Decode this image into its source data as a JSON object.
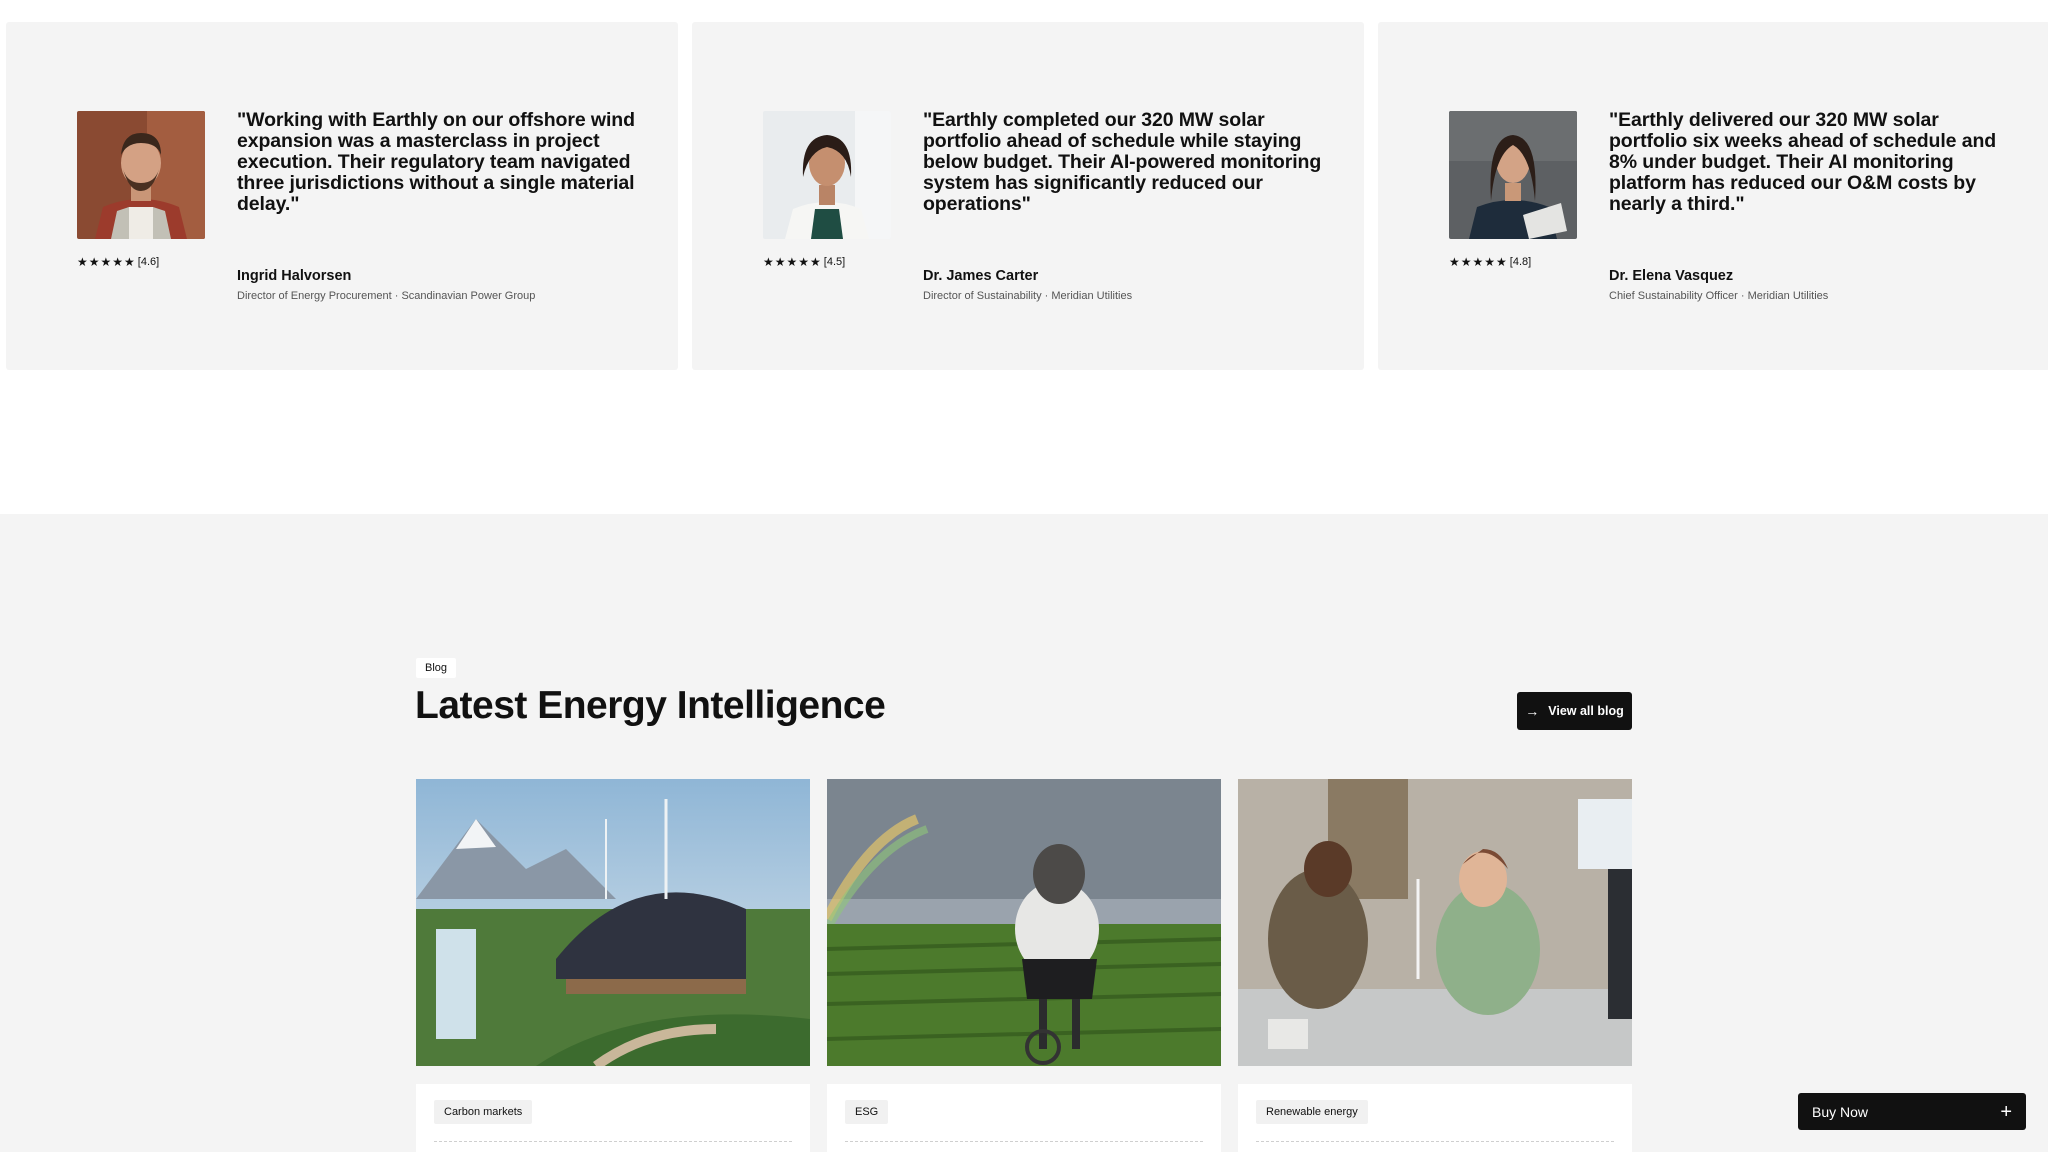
{
  "testimonials": [
    {
      "quote": "\"Working with Earthly on our offshore wind expansion was a masterclass in project execution. Their regulatory team navigated three jurisdictions without a single material delay.\"",
      "stars": "★★★★★",
      "rating": "[4.6]",
      "name": "Ingrid Halvorsen",
      "role": "Director of Energy Procurement · Scandinavian Power Group"
    },
    {
      "quote": "\"Earthly completed our 320 MW solar portfolio ahead of schedule while staying below budget. Their AI-powered monitoring system has significantly reduced our operations\"",
      "stars": "★★★★★",
      "rating": "[4.5]",
      "name": "Dr. James Carter",
      "role": "Director of Sustainability · Meridian Utilities"
    },
    {
      "quote": "\"Earthly delivered our 320 MW solar portfolio six weeks ahead of schedule and 8% under budget. Their AI monitoring platform has reduced our O&M costs by nearly a third.\"",
      "stars": "★★★★★",
      "rating": "[4.8]",
      "name": "Dr. Elena Vasquez",
      "role": "Chief Sustainability Officer · Meridian Utilities"
    }
  ],
  "blog": {
    "tag": "Blog",
    "title": "Latest Energy Intelligence",
    "view_all_label": "View all blog",
    "view_all_icon": "arrow-right-icon",
    "posts": [
      {
        "category": "Carbon markets"
      },
      {
        "category": "ESG"
      },
      {
        "category": "Renewable energy"
      }
    ]
  },
  "buy_now": {
    "label": "Buy Now",
    "icon": "plus-icon"
  }
}
